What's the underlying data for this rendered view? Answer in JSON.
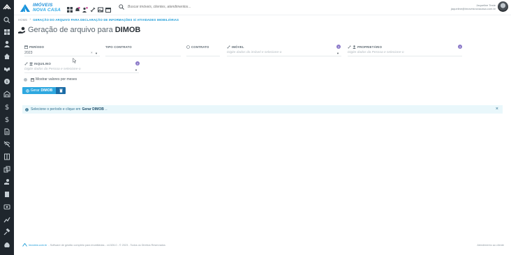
{
  "brand": {
    "line1": "IMÓVEIS",
    "line2": "NOVA CASA",
    "color": "#1c8fd9"
  },
  "search": {
    "placeholder": "Buscar imóveis, clientes, atendimentos..."
  },
  "user": {
    "name": "Jaqueline Teste",
    "email": "jaqueline@imoveisnovacasa.com.br"
  },
  "tools": [
    "grid-icon",
    "bell-icon",
    "users-icon",
    "link-icon",
    "image-icon",
    "calendar-icon"
  ],
  "sidebar": {
    "items": [
      "search-icon",
      "dashboard-icon",
      "user-icon",
      "home-icon",
      "handshake-icon",
      "coin-icon",
      "building-icon",
      "dollar-icon",
      "dollar-icon",
      "file-icon",
      "no-wifi-icon",
      "book-icon",
      "copy-icon",
      "hand-coin-icon",
      "page-icon",
      "badge-icon",
      "chart-icon",
      "gavel-icon",
      "settings-icon",
      "money-bag-icon"
    ]
  },
  "breadcrumb": {
    "home": "HOME",
    "current": "GERAÇÃO DO ARQUIVO PARA DECLARAÇÃO DE INFORMAÇÕES S/ ATIVIDADES IMOBILIÁRIAS"
  },
  "page": {
    "title_prefix": "Geração de arquivo para",
    "title_bold": "DIMOB"
  },
  "form": {
    "periodo": {
      "label": "PERÍODO",
      "value": "2023"
    },
    "tipo_contrato": {
      "label": "TIPO CONTRATO"
    },
    "contrato": {
      "label": "CONTRATO"
    },
    "imovel": {
      "label": "IMÓVEL",
      "placeholder": "Digite dados do imóvel e selecione-o"
    },
    "proprietario": {
      "label": "PROPRIETÁRIO",
      "placeholder": "Digite dados da Pessoa e selecione-o"
    },
    "inquilino": {
      "label": "INQUILINO",
      "placeholder": "Digite dados da Pessoa e selecione-o"
    },
    "help": "?",
    "clear": "×"
  },
  "toggle": {
    "label": "Mostrar valores por meses"
  },
  "buttons": {
    "gerar_prefix": "Gerar",
    "gerar_bold": "DIMOB"
  },
  "alert": {
    "prefix": "Selecione o período e clique em",
    "bold": "Gerar DIMOB",
    "suffix": "..",
    "close": "×"
  },
  "footer": {
    "brand": "Imoview.com.br",
    "text": "- Software de gestão completo para imobiliárias - v4.526.0 - © 2023 - Todos os Direitos Reservados",
    "right": "Atendimento ao cliente"
  },
  "colors": {
    "sidebar": "#1f262d",
    "accent": "#2ea8e0",
    "dark_accent": "#1b6ca6",
    "help": "#8a78c8",
    "alert_bg": "#e9f7fb"
  }
}
